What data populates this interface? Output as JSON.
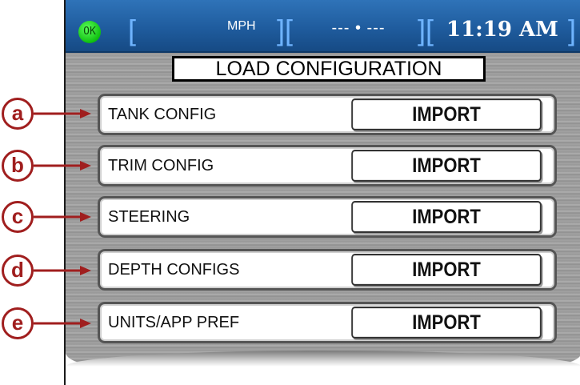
{
  "status_bar": {
    "ok_label": "OK",
    "speed_unit": "MPH",
    "heading": "--- • ---",
    "clock": "11:19 AM"
  },
  "page_title": "LOAD CONFIGURATION",
  "rows": [
    {
      "callout": "a",
      "label": "TANK CONFIG",
      "button": "IMPORT"
    },
    {
      "callout": "b",
      "label": "TRIM CONFIG",
      "button": "IMPORT"
    },
    {
      "callout": "c",
      "label": "STEERING",
      "button": "IMPORT"
    },
    {
      "callout": "d",
      "label": "DEPTH CONFIGS",
      "button": "IMPORT"
    },
    {
      "callout": "e",
      "label": "UNITS/APP PREF",
      "button": "IMPORT"
    }
  ],
  "colors": {
    "status_bar": "#1f5c9e",
    "ok_indicator": "#10c010",
    "callout": "#a01e1e"
  }
}
